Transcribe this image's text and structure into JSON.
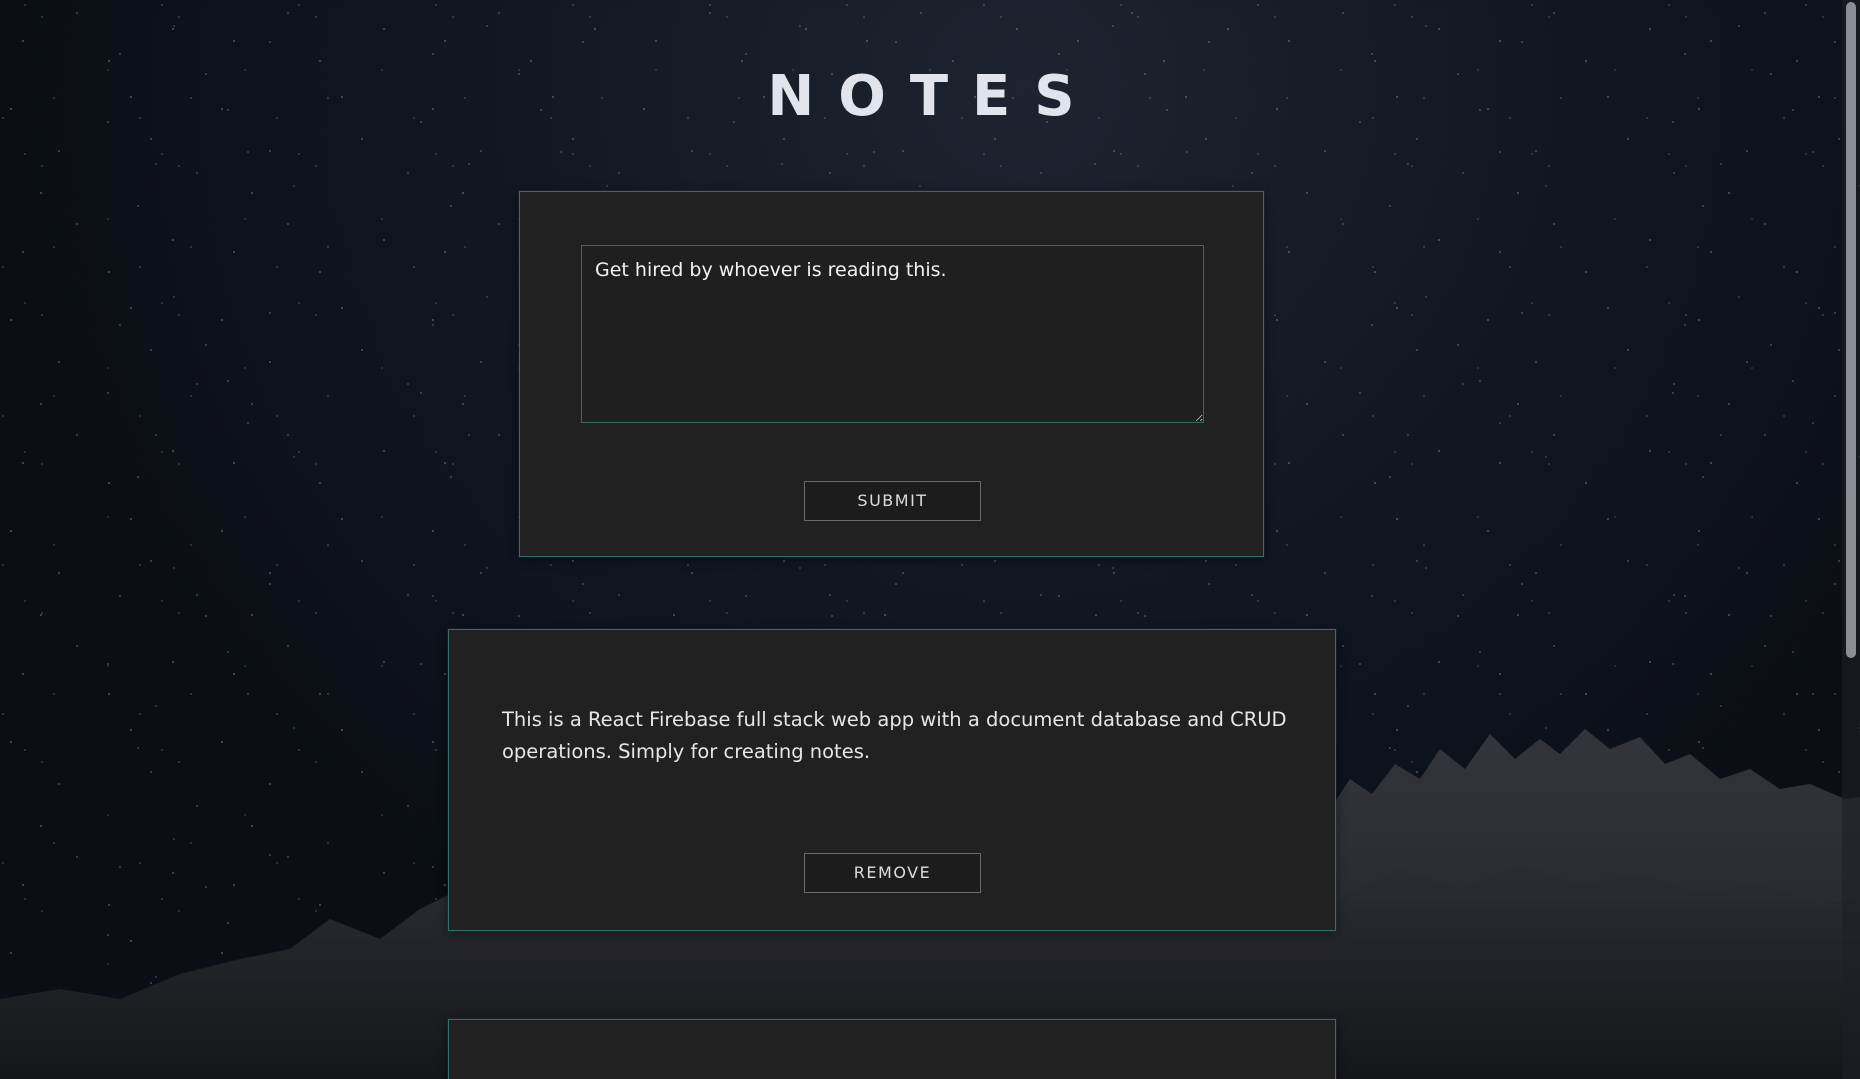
{
  "app": {
    "title": "NOTES"
  },
  "composer": {
    "input_value": "Get hired by whoever is reading this.",
    "submit_label": "SUBMIT"
  },
  "notes": [
    {
      "text": "This is a React Firebase full stack web app with a document database and CRUD operations. Simply for creating notes.",
      "remove_label": "REMOVE"
    }
  ],
  "colors": {
    "card_background": "#212121",
    "card_border": "#2f6f66",
    "button_border": "#6a6a6a",
    "title_color": "#e1e4ec"
  }
}
